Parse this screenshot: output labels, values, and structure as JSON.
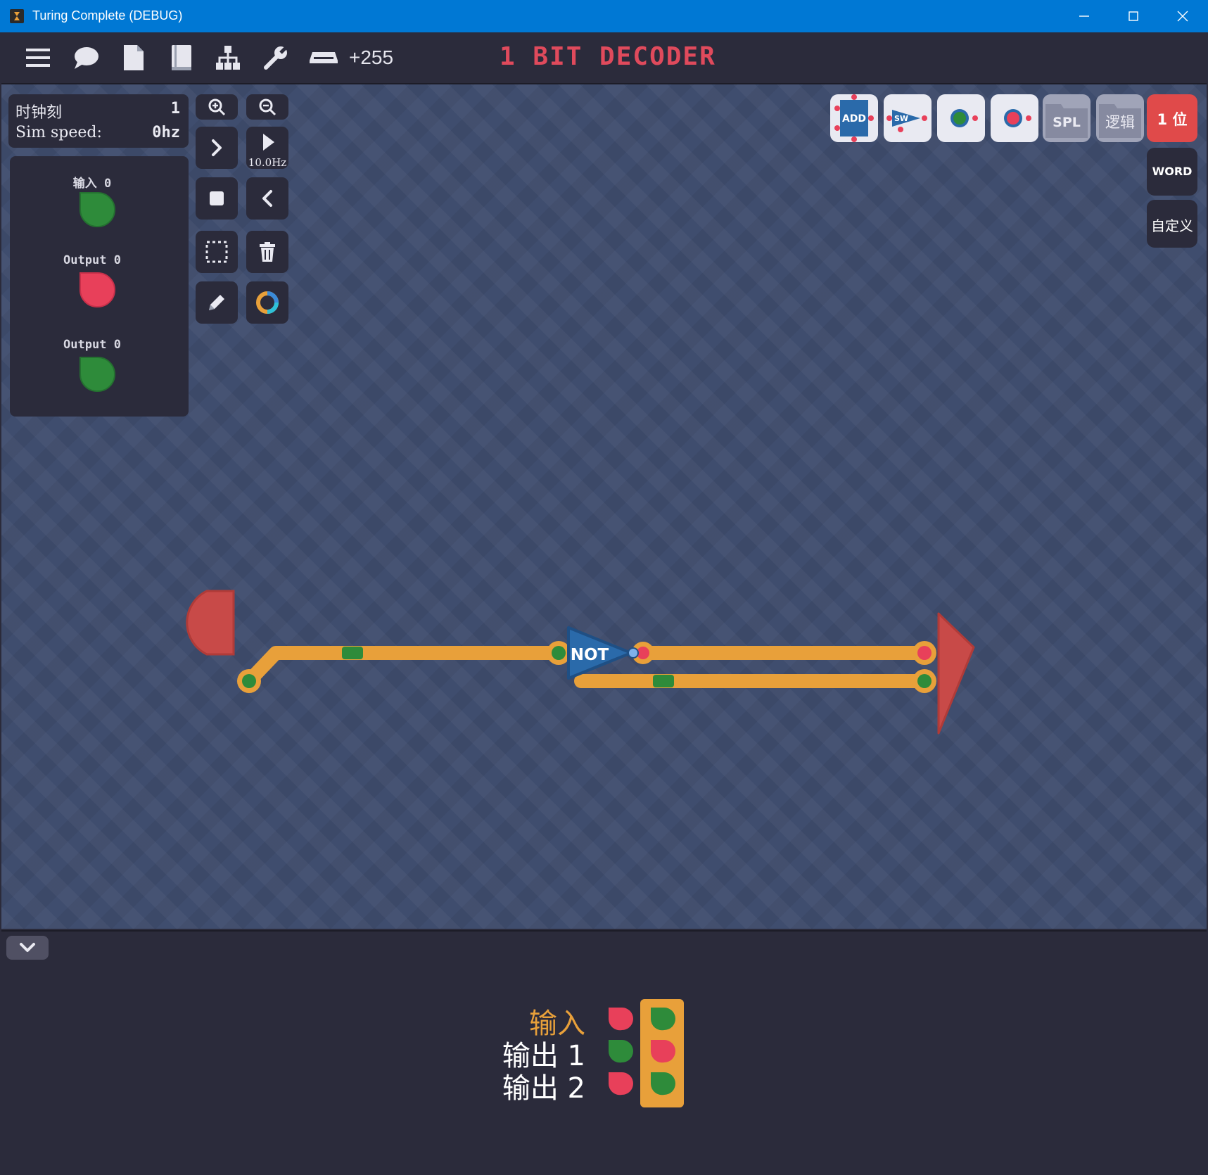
{
  "window": {
    "title": "Turing Complete (DEBUG)",
    "controls": [
      "minimize-icon",
      "maximize-icon",
      "close-icon"
    ],
    "titlebar_color": "#0078d4"
  },
  "toolbar": {
    "icons": [
      "menu-icon",
      "chat-icon",
      "document-icon",
      "book-icon",
      "hierarchy-icon",
      "wrench-icon",
      "scanner-icon"
    ],
    "score": "+255",
    "level_title": "1 BIT DECODER",
    "level_title_color": "#e04a5c"
  },
  "stats": {
    "tick_label": "时钟刻",
    "tick_value": "1",
    "speed_label": "Sim speed:",
    "speed_value": "0hz"
  },
  "io_panel": {
    "items": [
      {
        "label": "输入 0",
        "state": "green"
      },
      {
        "label": "Output 0",
        "state": "red"
      },
      {
        "label": "Output 0",
        "state": "green"
      }
    ]
  },
  "controls": {
    "zoom_in": "zoom-in-icon",
    "zoom_out": "zoom-out-icon",
    "step": "step-forward-icon",
    "play": "play-icon",
    "play_speed": "10.0Hz",
    "stop": "stop-icon",
    "back": "step-back-icon",
    "select": "select-area-icon",
    "delete": "trash-icon",
    "pencil": "pencil-icon",
    "color": "color-wheel-icon"
  },
  "components": {
    "add": "ADD",
    "switch": "SW",
    "spl": "SPL",
    "logic": "逻辑",
    "bit": "1 位",
    "word": "WORD",
    "custom": "自定义"
  },
  "circuit": {
    "gate_label": "NOT"
  },
  "truth_table": {
    "rows": [
      {
        "label": "输入",
        "expected": "red",
        "actual": "green",
        "color": "#e8a03a"
      },
      {
        "label": "输出 1",
        "expected": "green",
        "actual": "red",
        "color": "#ffffff"
      },
      {
        "label": "输出 2",
        "expected": "red",
        "actual": "green",
        "color": "#ffffff"
      }
    ]
  },
  "colors": {
    "canvas": "#3f4d6e",
    "wire": "#e8a03a",
    "on": "#2e8b3a",
    "off": "#e8405a",
    "panel": "#2b2b3b"
  }
}
